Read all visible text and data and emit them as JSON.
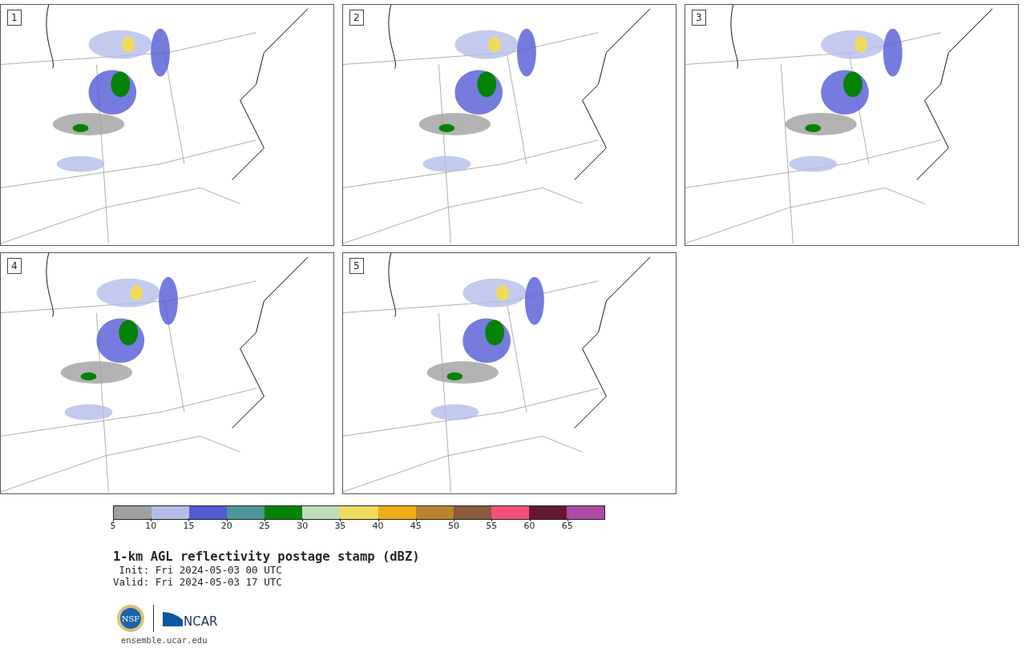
{
  "panels": [
    {
      "label": "1"
    },
    {
      "label": "2"
    },
    {
      "label": "3"
    },
    {
      "label": "4"
    },
    {
      "label": "5"
    }
  ],
  "colorbar": {
    "segments": [
      {
        "color": "#a0a0a0"
      },
      {
        "color": "#b4bdea"
      },
      {
        "color": "#525bd6"
      },
      {
        "color": "#4e959c"
      },
      {
        "color": "#048304"
      },
      {
        "color": "#bddcbc"
      },
      {
        "color": "#efda5d"
      },
      {
        "color": "#eeac15"
      },
      {
        "color": "#ba832f"
      },
      {
        "color": "#8b5b3e"
      },
      {
        "color": "#f5507c"
      },
      {
        "color": "#641937"
      },
      {
        "color": "#ab4aa4"
      }
    ],
    "ticks": [
      "5",
      "10",
      "15",
      "20",
      "25",
      "30",
      "35",
      "40",
      "45",
      "50",
      "55",
      "60",
      "65"
    ]
  },
  "title": "1-km AGL reflectivity postage stamp (dBZ)",
  "init": " Init: Fri 2024-05-03 00 UTC",
  "valid": "Valid: Fri 2024-05-03 17 UTC",
  "logos": {
    "nsf": "NSF",
    "ncar": "NCAR"
  },
  "site": "ensemble.ucar.edu"
}
